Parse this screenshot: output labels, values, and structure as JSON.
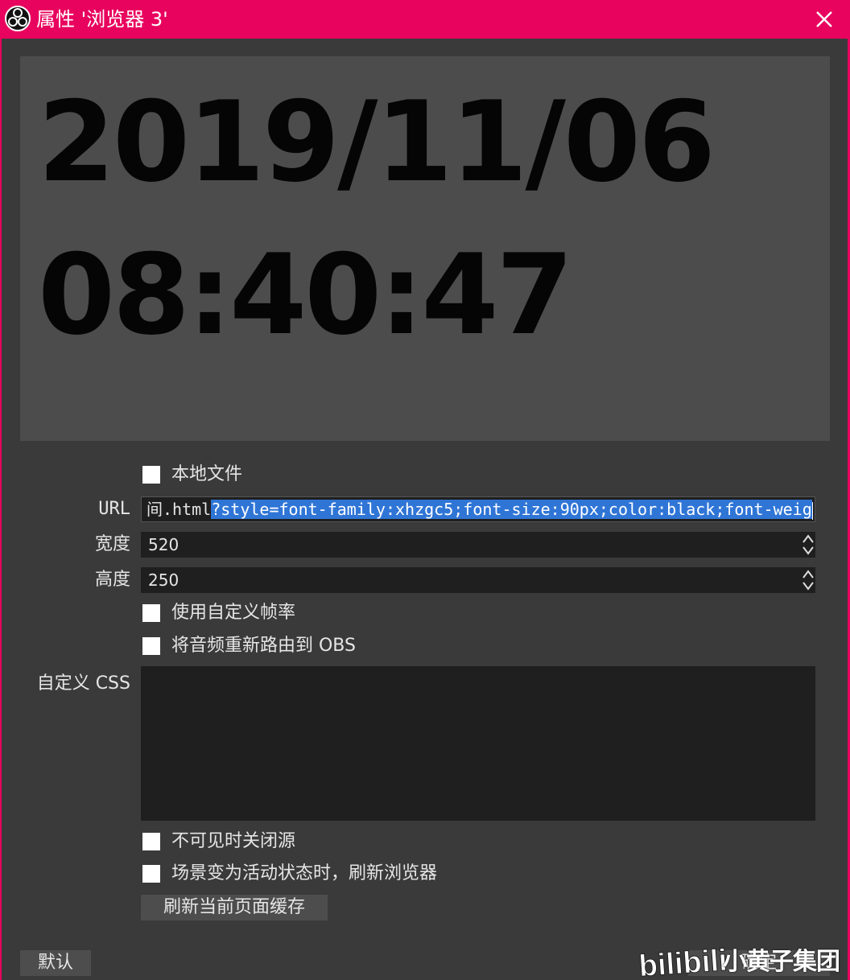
{
  "window": {
    "title": "属性 '浏览器 3'"
  },
  "preview": {
    "date_line": "2019/11/06",
    "time_line": "08:40:47"
  },
  "form": {
    "local_file_label": "本地文件",
    "url_label": "URL",
    "url_value_prefix": "间.html",
    "url_value_selected": "?style=font-family:xhzgc5;font-size:90px;color:black;font-weig",
    "width_label": "宽度",
    "width_value": "520",
    "height_label": "高度",
    "height_value": "250",
    "custom_fps_label": "使用自定义帧率",
    "reroute_audio_label": "将音频重新路由到 OBS",
    "custom_css_label": "自定义 CSS",
    "shutdown_invisible_label": "不可见时关闭源",
    "refresh_active_label": "场景变为活动状态时，刷新浏览器",
    "refresh_cache_button": "刷新当前页面缓存"
  },
  "footer": {
    "default_button": "默认",
    "ok_button_partial": "确定"
  },
  "watermark": {
    "text": "小黄子集团"
  },
  "colors": {
    "accent": "#e8045e",
    "background": "#3a3a3a",
    "field": "#1f1f1f",
    "selection": "#2f75d6",
    "preview_bg": "#4c4c4c"
  }
}
